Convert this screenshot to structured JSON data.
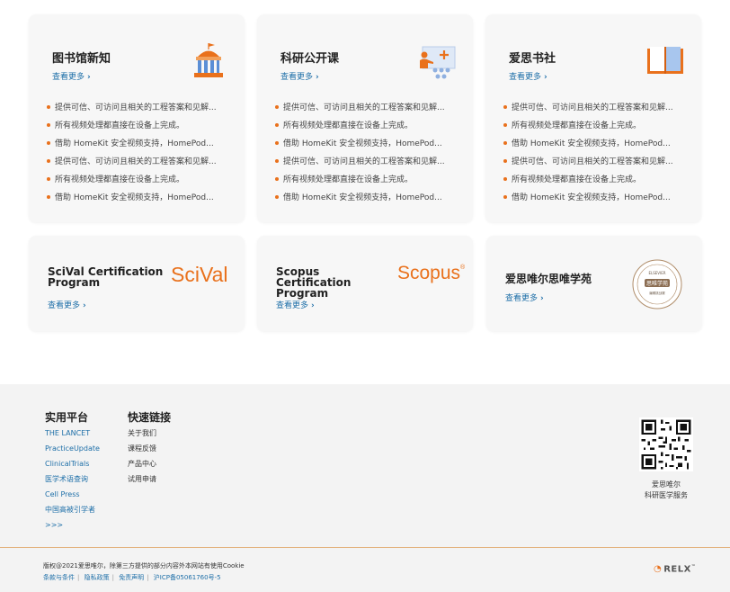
{
  "cards": [
    {
      "title": "图书馆新知",
      "more": "查看更多",
      "icon": "library-building-icon",
      "items": [
        "提供可信、可访问且相关的工程答案和见解...",
        "所有视频处理都直接在设备上完成。",
        "借助 HomeKit 安全视频支持，HomePod...",
        "提供可信、可访问且相关的工程答案和见解...",
        "所有视频处理都直接在设备上完成。",
        "借助 HomeKit 安全视频支持，HomePod..."
      ]
    },
    {
      "title": "科研公开课",
      "more": "查看更多",
      "icon": "presentation-lecture-icon",
      "items": [
        "提供可信、可访问且相关的工程答案和见解...",
        "所有视频处理都直接在设备上完成。",
        "借助 HomeKit 安全视频支持，HomePod...",
        "提供可信、可访问且相关的工程答案和见解...",
        "所有视频处理都直接在设备上完成。",
        "借助 HomeKit 安全视频支持，HomePod..."
      ]
    },
    {
      "title": "爱思书社",
      "more": "查看更多",
      "icon": "open-book-icon",
      "items": [
        "提供可信、可访问且相关的工程答案和见解...",
        "所有视频处理都直接在设备上完成。",
        "借助 HomeKit 安全视频支持，HomePod...",
        "提供可信、可访问且相关的工程答案和见解...",
        "所有视频处理都直接在设备上完成。",
        "借助 HomeKit 安全视频支持，HomePod..."
      ]
    }
  ],
  "certs": [
    {
      "title": "SciVal Certification Program",
      "logo": "SciVal",
      "more": "查看更多"
    },
    {
      "title": "Scopus Certification Program",
      "logo": "Scopus",
      "logo_mark": "®",
      "more": "查看更多"
    },
    {
      "title": "爱思唯尔思唯学苑",
      "logo": "思唯学苑",
      "logo_top": "ELSEVIER",
      "logo_sub": "编辑挑战赛",
      "more": "查看更多"
    }
  ],
  "footer": {
    "col1_title": "实用平台",
    "col1_links": [
      "THE LANCET",
      "PracticeUpdate",
      "ClinicalTrials",
      "医学术语查询",
      "Cell Press",
      "中国高被引学者",
      ">>>"
    ],
    "col2_title": "快速链接",
    "col2_links": [
      "关于我们",
      "课程反馈",
      "产品中心",
      "试用申请"
    ],
    "qr_caption_1": "爱思唯尔",
    "qr_caption_2": "科研医学服务",
    "copyright": "版权@2021爱思唯尔，除第三方提供的部分内容外本网站有使用Cookie",
    "legal_links": [
      "条款与条件",
      "隐私政策",
      "免责声明",
      "沪ICP备05061760号-5"
    ],
    "relx": "RELX",
    "relx_mark": "™"
  },
  "colors": {
    "accent": "#e9711c",
    "link": "#1e6fa8",
    "card_bg": "#f7f7f7",
    "footer_bg": "#f3f3f3"
  }
}
